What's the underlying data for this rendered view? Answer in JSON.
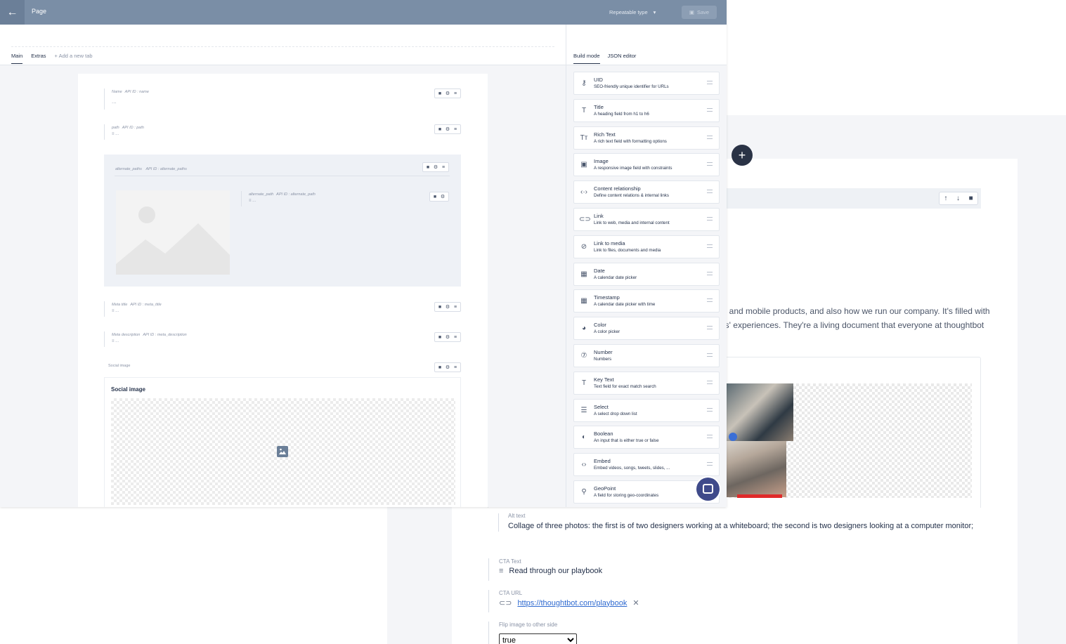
{
  "topbar": {
    "back_icon": "arrow-left-icon",
    "title": "Page",
    "repeatable_type": "Repeatable type",
    "save_label": "Save"
  },
  "editor": {
    "tabs": [
      {
        "label": "Main",
        "active": true
      },
      {
        "label": "Extras",
        "active": false
      }
    ],
    "add_tab_label": "+ Add a new tab",
    "fields": {
      "name": {
        "label": "Name",
        "api": "API ID : name",
        "placeholder": "..."
      },
      "path": {
        "label": "path",
        "api": "API ID : path",
        "placeholder": "..."
      },
      "alternate_paths": {
        "label": "alternate_paths",
        "api": "API ID : alternate_paths"
      },
      "alternate_path": {
        "label": "alternate_path",
        "api": "API ID : alternate_path",
        "placeholder": "..."
      },
      "meta_title": {
        "label": "Meta title",
        "api": "API ID : meta_title",
        "placeholder": "..."
      },
      "meta_description": {
        "label": "Meta description",
        "api": "API ID : meta_description",
        "placeholder": "..."
      },
      "social_image": {
        "label": "Social image",
        "title": "Social image"
      }
    }
  },
  "sidebar": {
    "tabs": [
      {
        "label": "Build mode",
        "active": true
      },
      {
        "label": "JSON editor",
        "active": false
      }
    ],
    "fields": [
      {
        "icon": "key-icon",
        "glyph": "⚷",
        "name": "UID",
        "desc": "SEO-friendly unique identifier for URLs"
      },
      {
        "icon": "title-icon",
        "glyph": "T",
        "name": "Title",
        "desc": "A heading field from h1 to h6"
      },
      {
        "icon": "rich-text-icon",
        "glyph": "Tт",
        "name": "Rich Text",
        "desc": "A rich text field with formatting options"
      },
      {
        "icon": "image-icon",
        "glyph": "▣",
        "name": "Image",
        "desc": "A responsive image field with constraints"
      },
      {
        "icon": "code-icon",
        "glyph": "‹·›",
        "name": "Content relationship",
        "desc": "Define content relations & internal links"
      },
      {
        "icon": "link-icon",
        "glyph": "⊂⊃",
        "name": "Link",
        "desc": "Link to web, media and internal content"
      },
      {
        "icon": "attachment-icon",
        "glyph": "⊘",
        "name": "Link to media",
        "desc": "Link to files, documents and media"
      },
      {
        "icon": "calendar-icon",
        "glyph": "▦",
        "name": "Date",
        "desc": "A calendar date picker"
      },
      {
        "icon": "calendar-clock-icon",
        "glyph": "▦",
        "name": "Timestamp",
        "desc": "A calendar date picker with time"
      },
      {
        "icon": "palette-icon",
        "glyph": "◕",
        "name": "Color",
        "desc": "A color picker"
      },
      {
        "icon": "number-icon",
        "glyph": "⑦",
        "name": "Number",
        "desc": "Numbers"
      },
      {
        "icon": "key-text-icon",
        "glyph": "T",
        "name": "Key Text",
        "desc": "Text field for exact match search"
      },
      {
        "icon": "select-icon",
        "glyph": "☰",
        "name": "Select",
        "desc": "A select drop down list"
      },
      {
        "icon": "toggle-icon",
        "glyph": "◐",
        "name": "Boolean",
        "desc": "An input that is either true or false"
      },
      {
        "icon": "embed-icon",
        "glyph": "‹›",
        "name": "Embed",
        "desc": "Embed videos, songs, tweets, slides, ..."
      },
      {
        "icon": "location-pin-icon",
        "glyph": "⚲",
        "name": "GeoPoint",
        "desc": "A field for storing geo-coordinates"
      }
    ]
  },
  "background": {
    "body_lines": [
      "eb and mobile products, and also how we run our company. It's filled with",
      "ers' experiences. They're a living document that everyone at thoughtbot"
    ],
    "alt_text": {
      "label": "Alt text",
      "value": "Collage of three photos: the first is of two designers working at a whiteboard; the second is two designers looking at a computer monitor;"
    },
    "cta_text": {
      "label": "CTA Text",
      "value": "Read through our playbook"
    },
    "cta_url": {
      "label": "CTA URL",
      "value": "https://thoughtbot.com/playbook"
    },
    "flip_image": {
      "label": "Flip image to other side",
      "value": "true"
    }
  },
  "colors": {
    "topbar": "#7a8ea6",
    "accent_dark": "#25324b",
    "chat": "#3f4a8a"
  }
}
